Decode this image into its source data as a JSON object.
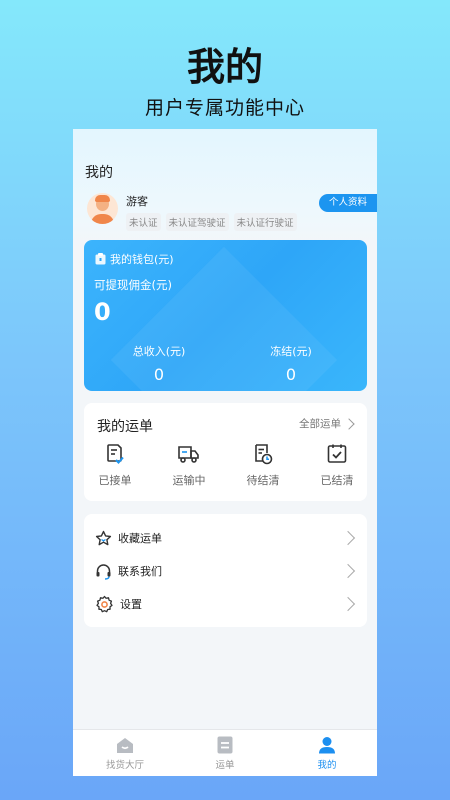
{
  "promo": {
    "title": "我的",
    "subtitle": "用户专属功能中心"
  },
  "page": {
    "heading": "我的"
  },
  "user": {
    "name": "游客",
    "tags": [
      "未认证",
      "未认证驾驶证",
      "未认证行驶证"
    ],
    "profile_button": "个人资料"
  },
  "wallet": {
    "title": "我的钱包(元)",
    "withdrawable_label": "可提现佣金(元)",
    "withdrawable_value": "0",
    "total_income_label": "总收入(元)",
    "total_income_value": "0",
    "frozen_label": "冻结(元)",
    "frozen_value": "0"
  },
  "orders": {
    "title": "我的运单",
    "all_link": "全部运单",
    "items": [
      {
        "label": "已接单",
        "icon": "accepted-order-icon"
      },
      {
        "label": "运输中",
        "icon": "truck-icon"
      },
      {
        "label": "待结清",
        "icon": "pending-settlement-icon"
      },
      {
        "label": "已结清",
        "icon": "settled-icon"
      }
    ]
  },
  "menu": {
    "items": [
      {
        "label": "收藏运单",
        "icon": "star-icon"
      },
      {
        "label": "联系我们",
        "icon": "headset-icon"
      },
      {
        "label": "设置",
        "icon": "gear-icon"
      }
    ]
  },
  "tabbar": {
    "items": [
      {
        "label": "找货大厅",
        "icon": "home-icon",
        "active": false
      },
      {
        "label": "运单",
        "icon": "document-icon",
        "active": false
      },
      {
        "label": "我的",
        "icon": "user-icon",
        "active": true
      }
    ]
  },
  "colors": {
    "accent": "#1c95f0",
    "wallet_bg": "#2ea6f8",
    "icon_orange": "#f0864a"
  }
}
